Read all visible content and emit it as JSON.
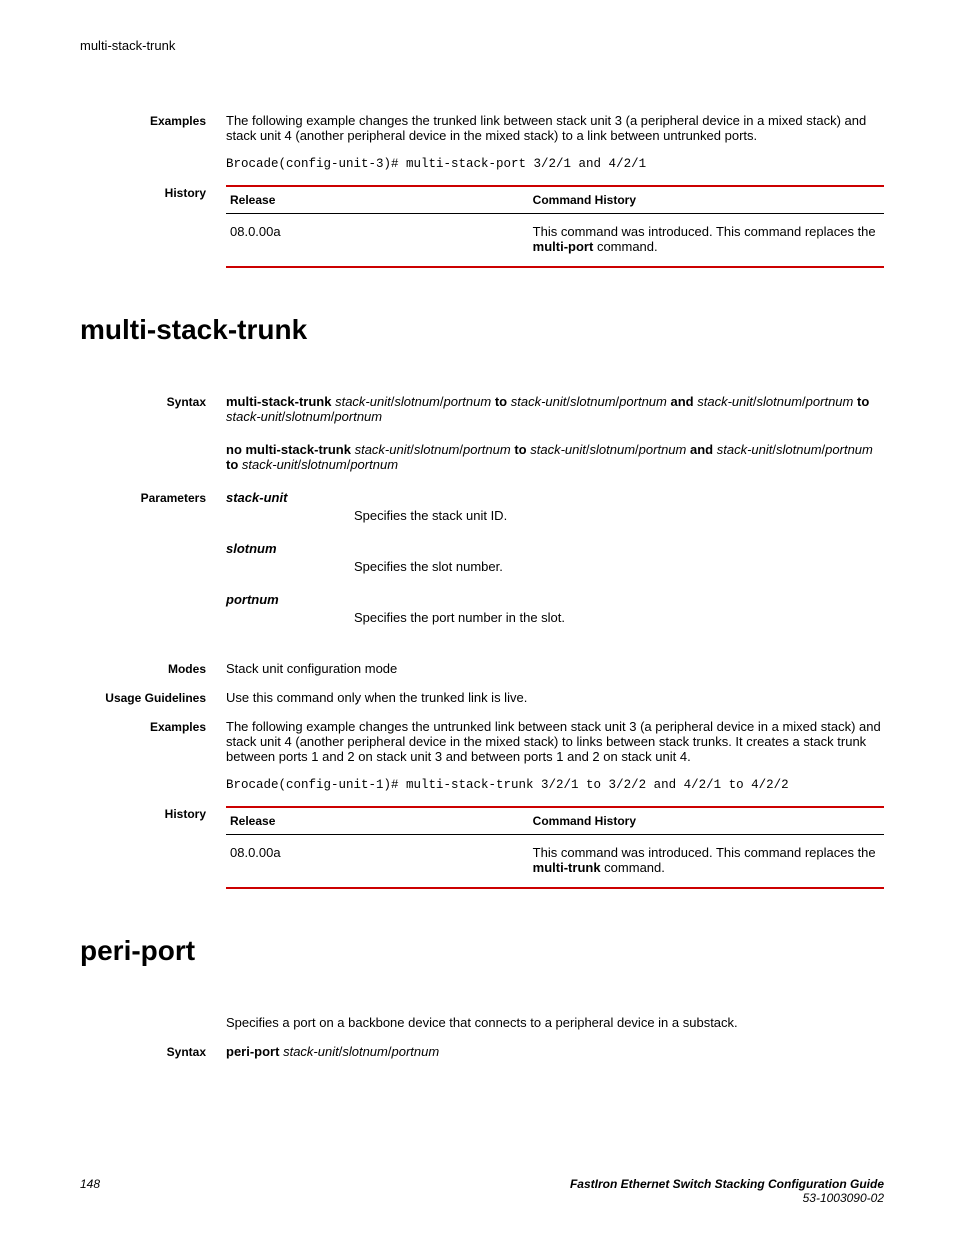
{
  "running_head": "multi-stack-trunk",
  "top": {
    "examples_label": "Examples",
    "examples_text": "The following example changes the trunked link between stack unit 3 (a peripheral device in a mixed stack) and stack unit 4 (another peripheral device in the mixed stack) to a link between untrunked ports.",
    "examples_code": "Brocade(config-unit-3)# multi-stack-port 3/2/1 and 4/2/1",
    "history_label": "History",
    "history": {
      "release_hdr": "Release",
      "cmdhist_hdr": "Command History",
      "release_val": "08.0.00a",
      "cmdhist_pre": "This command was introduced. This command replaces the ",
      "cmdhist_bold": "multi-port",
      "cmdhist_post": " command."
    }
  },
  "mst": {
    "title": "multi-stack-trunk",
    "syntax_label": "Syntax",
    "syntax1": {
      "cmd": "multi-stack-trunk",
      "su": "stack-unit",
      "sl": "slotnum",
      "pn": "portnum",
      "to": "to",
      "and": "and"
    },
    "syntax2": {
      "cmd": "no multi-stack-trunk",
      "su": "stack-unit",
      "sl": "slotnum",
      "pn": "portnum",
      "to": "to",
      "and": "and"
    },
    "parameters_label": "Parameters",
    "params": [
      {
        "name": "stack-unit",
        "desc": "Specifies the stack unit ID."
      },
      {
        "name": "slotnum",
        "desc": "Specifies the slot number."
      },
      {
        "name": "portnum",
        "desc": "Specifies the port number in the slot."
      }
    ],
    "modes_label": "Modes",
    "modes_text": "Stack unit configuration mode",
    "usage_label": "Usage Guidelines",
    "usage_text": "Use this command only when the trunked link is live.",
    "examples_label": "Examples",
    "examples_text": "The following example changes the untrunked link between stack unit 3 (a peripheral device in a mixed stack) and stack unit 4 (another peripheral device in the mixed stack) to links between stack trunks. It creates a stack trunk between ports 1 and 2 on stack unit 3 and between ports 1 and 2 on stack unit 4.",
    "examples_code": "Brocade(config-unit-1)# multi-stack-trunk 3/2/1 to 3/2/2 and 4/2/1 to 4/2/2",
    "history_label": "History",
    "history": {
      "release_hdr": "Release",
      "cmdhist_hdr": "Command History",
      "release_val": "08.0.00a",
      "cmdhist_pre": "This command was introduced. This command replaces the ",
      "cmdhist_bold": "multi-trunk",
      "cmdhist_post": " command."
    }
  },
  "pp": {
    "title": "peri-port",
    "intro": "Specifies a port on a backbone device that connects to a peripheral device in a substack.",
    "syntax_label": "Syntax",
    "syntax": {
      "cmd": "peri-port",
      "su": "stack-unit",
      "sl": "slotnum",
      "pn": "portnum"
    }
  },
  "footer": {
    "pagenum": "148",
    "doctitle": "FastIron Ethernet Switch Stacking Configuration Guide",
    "docnum": "53-1003090-02"
  }
}
